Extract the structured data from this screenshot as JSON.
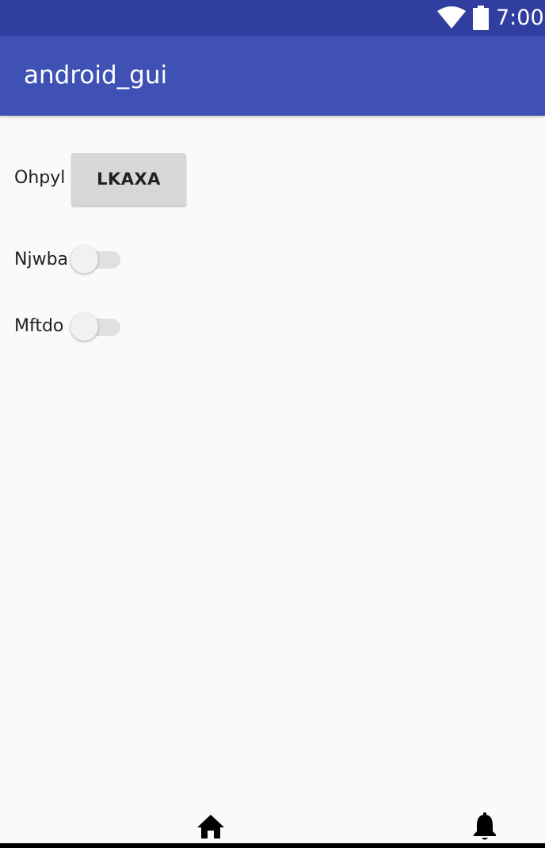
{
  "status_bar": {
    "time": "7:00",
    "icons": [
      "wifi-icon",
      "battery-icon"
    ],
    "color": "#303f9f"
  },
  "app_bar": {
    "title": "android_gui",
    "color": "#3f51b5"
  },
  "rows": [
    {
      "label": "Ohpyl",
      "control": "button",
      "button_label": "LKAXA"
    },
    {
      "label": "Njwba",
      "control": "switch",
      "checked": false
    },
    {
      "label": "Mftdo",
      "control": "switch",
      "checked": false
    }
  ],
  "bottom_nav": {
    "icons": [
      "home-icon",
      "bell-icon"
    ]
  }
}
